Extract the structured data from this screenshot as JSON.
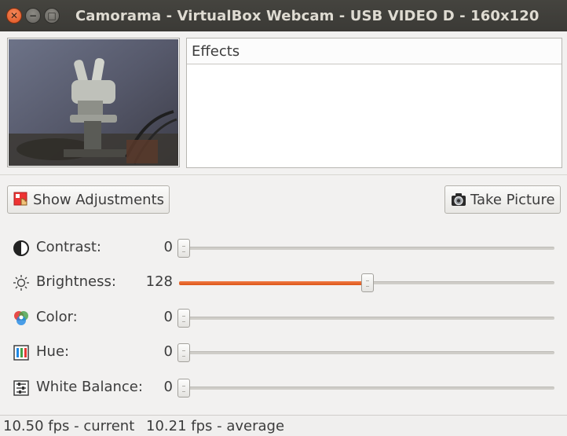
{
  "window": {
    "title": "Camorama - VirtualBox Webcam - USB VIDEO D - 160x120",
    "buttons": [
      "close",
      "minimize",
      "maximize"
    ]
  },
  "effects": {
    "header": "Effects"
  },
  "buttons": {
    "show_adjustments": "Show Adjustments",
    "take_picture": "Take Picture"
  },
  "sliders": [
    {
      "label": "Contrast:",
      "value": "0",
      "fraction": 0.0,
      "icon": "contrast-icon"
    },
    {
      "label": "Brightness:",
      "value": "128",
      "fraction": 0.5,
      "icon": "brightness-icon"
    },
    {
      "label": "Color:",
      "value": "0",
      "fraction": 0.0,
      "icon": "color-icon"
    },
    {
      "label": "Hue:",
      "value": "0",
      "fraction": 0.0,
      "icon": "hue-icon"
    },
    {
      "label": "White Balance:",
      "value": "0",
      "fraction": 0.0,
      "icon": "white-balance-icon"
    }
  ],
  "status": {
    "current": "10.50 fps - current",
    "average": "10.21 fps - average"
  },
  "colors": {
    "titlebar": "#3b3a36",
    "accent": "#dc5518",
    "background": "#f2f1f0"
  }
}
